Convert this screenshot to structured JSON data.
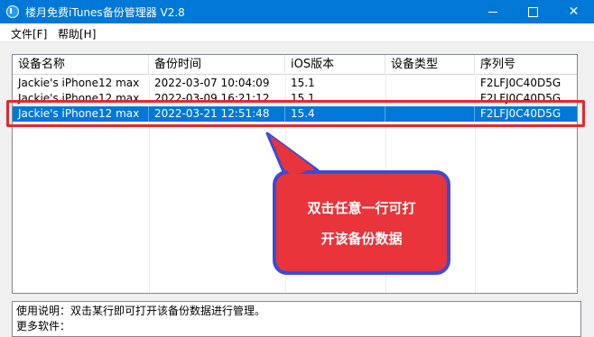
{
  "window": {
    "title": "楼月免费iTunes备份管理器 V2.8",
    "controls": {
      "minimize": "minimize",
      "maximize": "maximize",
      "close": "✕"
    }
  },
  "menu": [
    {
      "label": "文件[F]"
    },
    {
      "label": "帮助[H]"
    }
  ],
  "table": {
    "columns": [
      "设备名称",
      "备份时间",
      "iOS版本",
      "设备类型",
      "序列号"
    ],
    "rows": [
      {
        "device": "Jackie's iPhone12 max",
        "time": "2022-03-07 10:04:09",
        "ios": "15.1",
        "type": "",
        "serial": "F2LFJ0C40D5G",
        "selected": false
      },
      {
        "device": "Jackie's iPhone12 max",
        "time": "2022-03-09 16:21:12",
        "ios": "15.1",
        "type": "",
        "serial": "F2LFJ0C40D5G",
        "selected": false
      },
      {
        "device": "Jackie's iPhone12 max",
        "time": "2022-03-21 12:51:48",
        "ios": "15.4",
        "type": "",
        "serial": "F2LFJ0C40D5G",
        "selected": true
      }
    ]
  },
  "callout": {
    "line1": "双击任意一行可打",
    "line2": "开该备份数据",
    "color": "#e8343a"
  },
  "info": {
    "usage": "使用说明：双击某行即可打开该备份数据进行管理。",
    "more": "更多软件："
  },
  "colors": {
    "titlebar": "#0078d7",
    "selection": "#0078d7",
    "highlight": "#e8262c"
  }
}
